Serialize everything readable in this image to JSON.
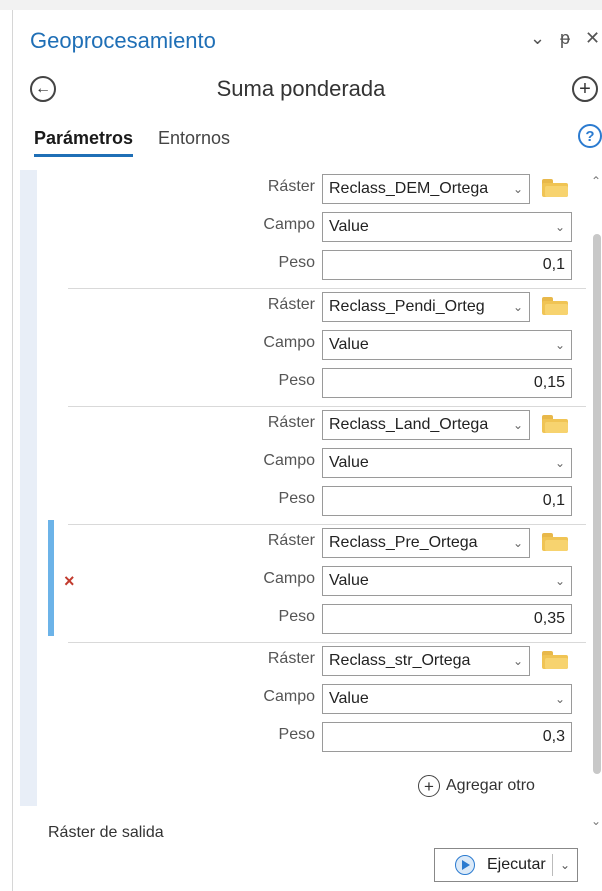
{
  "pane": {
    "title": "Geoprocesamiento",
    "controls": {
      "chevron": "⌄",
      "pin": "ᵽ",
      "close": "✕"
    }
  },
  "tool": {
    "title": "Suma ponderada",
    "back_icon": "arrow-left-circle-icon",
    "add_icon": "plus-circle-icon"
  },
  "tabs": [
    {
      "label": "Parámetros",
      "active": true
    },
    {
      "label": "Entornos",
      "active": false
    }
  ],
  "help_label": "?",
  "labels": {
    "raster": "Ráster",
    "campo": "Campo",
    "peso": "Peso"
  },
  "groups": [
    {
      "raster": "Reclass_DEM_Ortega",
      "campo": "Value",
      "peso": "0,1"
    },
    {
      "raster": "Reclass_Pendi_Orteg",
      "campo": "Value",
      "peso": "0,15"
    },
    {
      "raster": "Reclass_Land_Ortega",
      "campo": "Value",
      "peso": "0,1"
    },
    {
      "raster": "Reclass_Pre_Ortega",
      "campo": "Value",
      "peso": "0,35"
    },
    {
      "raster": "Reclass_str_Ortega",
      "campo": "Value",
      "peso": "0,3"
    }
  ],
  "add_other_label": "Agregar otro",
  "output_raster_label": "Ráster de salida",
  "run": {
    "label": "Ejecutar"
  },
  "colors": {
    "accent": "#1f6fb6",
    "active_bar": "#6cb3e8",
    "error": "#c23b2e",
    "folder": "#f0c454"
  }
}
